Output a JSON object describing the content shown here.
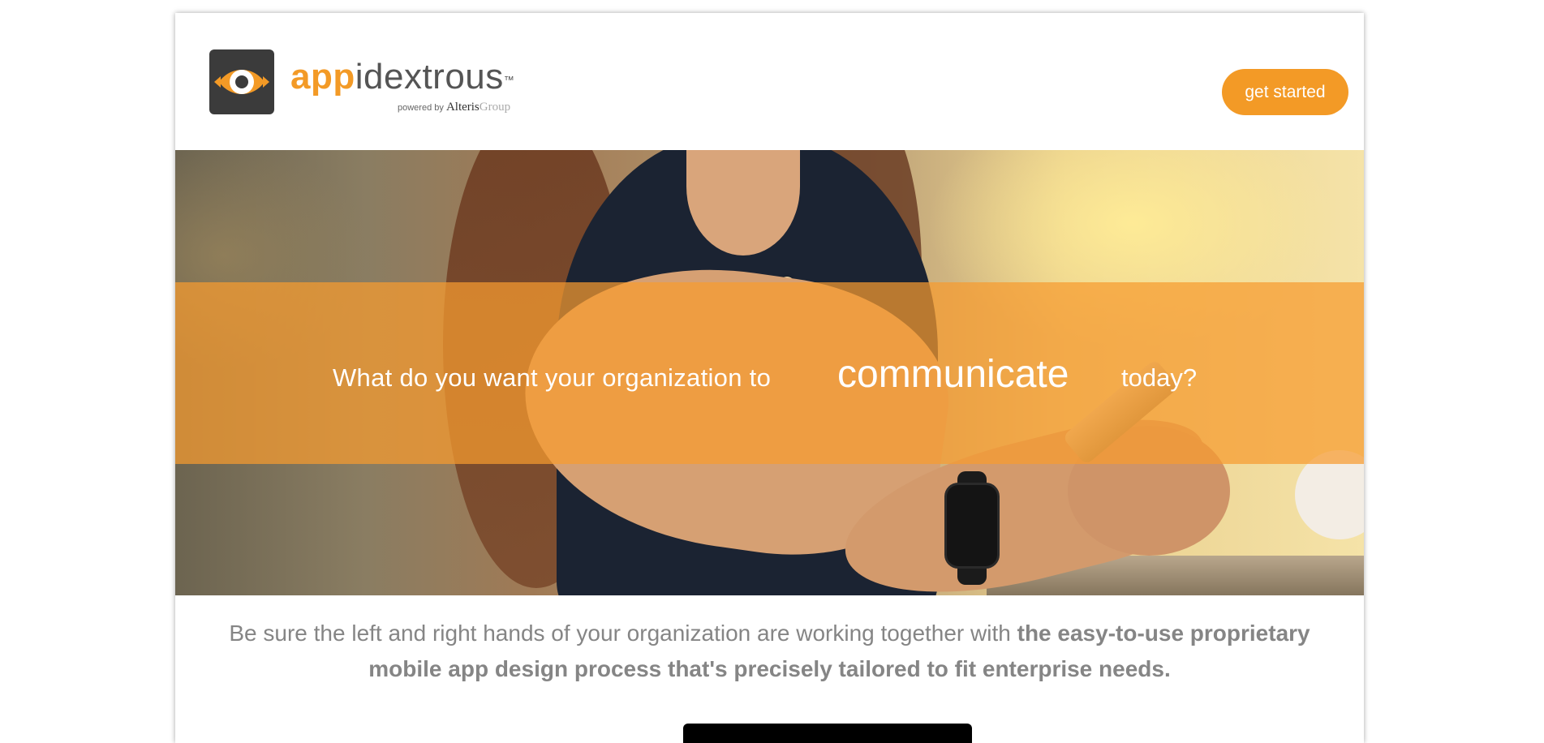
{
  "brand": {
    "name_part_1": "app",
    "name_part_2": "idextrous",
    "trademark": "™",
    "powered_by": "powered by",
    "parent_name_1": "Alteris",
    "parent_name_2": "Group",
    "accent_color": "#f39a26"
  },
  "header": {
    "cta_label": "get started"
  },
  "hero": {
    "lead": "What do you want your organization to",
    "highlight": "communicate",
    "tail": "today?"
  },
  "intro": {
    "plain": "Be sure the left and right hands of your organization are working together with ",
    "bold": "the easy-to-use proprietary mobile app design process that's precisely tailored to fit enterprise needs."
  }
}
